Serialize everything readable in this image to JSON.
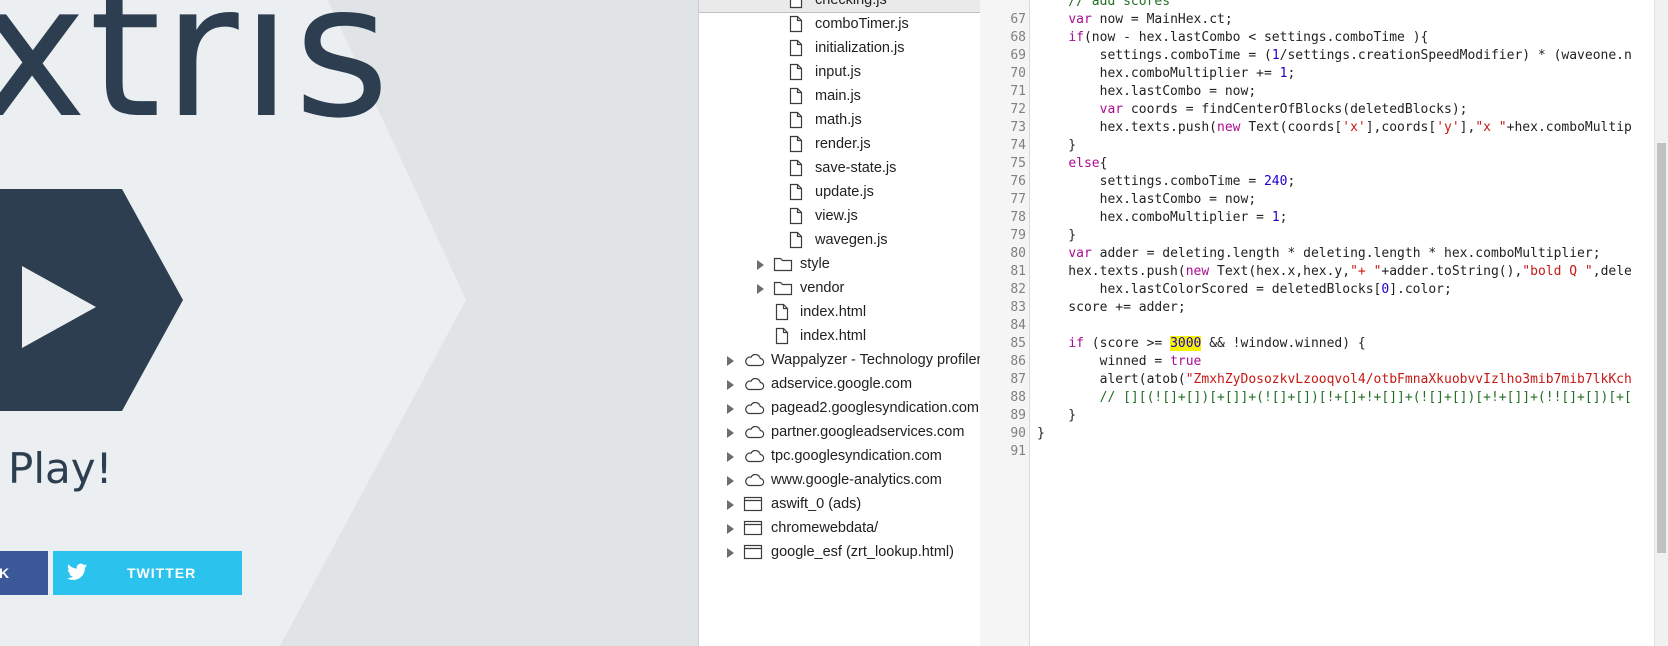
{
  "game": {
    "title": "xtris",
    "play_text": "Play!",
    "facebook_label": "K",
    "twitter_label": "TWITTER",
    "colors": {
      "background": "#e0e4e7",
      "hex_light": "#eceff1",
      "hex_dark": "#2c3e50",
      "facebook": "#3b5998",
      "twitter": "#2bc3ed"
    }
  },
  "file_tree": {
    "files": [
      "checking.js",
      "comboTimer.js",
      "initialization.js",
      "input.js",
      "main.js",
      "math.js",
      "render.js",
      "save-state.js",
      "update.js",
      "view.js",
      "wavegen.js"
    ],
    "folders": [
      "style",
      "vendor"
    ],
    "root_files": [
      "index.html",
      "index.html"
    ],
    "domains": [
      {
        "label": "Wappalyzer - Technology profiler",
        "icon": "cloud-icon"
      },
      {
        "label": "adservice.google.com",
        "icon": "cloud-icon"
      },
      {
        "label": "pagead2.googlesyndication.com",
        "icon": "cloud-icon"
      },
      {
        "label": "partner.googleadservices.com",
        "icon": "cloud-icon"
      },
      {
        "label": "tpc.googlesyndication.com",
        "icon": "cloud-icon"
      },
      {
        "label": "www.google-analytics.com",
        "icon": "cloud-icon"
      },
      {
        "label": "aswift_0 (ads)",
        "icon": "frame-icon"
      },
      {
        "label": "chromewebdata/",
        "icon": "frame-icon"
      },
      {
        "label": "google_esf (zrt_lookup.html)",
        "icon": "frame-icon"
      }
    ]
  },
  "editor": {
    "first_line_partial": "    // add scores",
    "lines": [
      {
        "n": "67",
        "html": "    <span class='kw'>var</span> now = MainHex.ct;"
      },
      {
        "n": "68",
        "html": "    <span class='kw'>if</span>(now - hex.lastCombo &lt; settings.comboTime ){"
      },
      {
        "n": "69",
        "html": "        settings.comboTime = (<span class='num'>1</span>/settings.creationSpeedModifier) * (waveone.n"
      },
      {
        "n": "70",
        "html": "        hex.comboMultiplier += <span class='num'>1</span>;"
      },
      {
        "n": "71",
        "html": "        hex.lastCombo = now;"
      },
      {
        "n": "72",
        "html": "        <span class='kw'>var</span> coords = findCenterOfBlocks(deletedBlocks);"
      },
      {
        "n": "73",
        "html": "        hex.texts.push(<span class='kw'>new</span> Text(coords[<span class='str'>'x'</span>],coords[<span class='str'>'y'</span>],<span class='str'>\"x \"</span>+hex.comboMultip"
      },
      {
        "n": "74",
        "html": "    }"
      },
      {
        "n": "75",
        "html": "    <span class='kw'>else</span>{"
      },
      {
        "n": "76",
        "html": "        settings.comboTime = <span class='num'>240</span>;"
      },
      {
        "n": "77",
        "html": "        hex.lastCombo = now;"
      },
      {
        "n": "78",
        "html": "        hex.comboMultiplier = <span class='num'>1</span>;"
      },
      {
        "n": "79",
        "html": "    }"
      },
      {
        "n": "80",
        "html": "    <span class='kw'>var</span> adder = deleting.length * deleting.length * hex.comboMultiplier;"
      },
      {
        "n": "81",
        "html": "    hex.texts.push(<span class='kw'>new</span> Text(hex.x,hex.y,<span class='str'>\"+ \"</span>+adder.toString(),<span class='str'>\"bold Q \"</span>,dele"
      },
      {
        "n": "82",
        "html": "        hex.lastColorScored = deletedBlocks[<span class='num'>0</span>].color;"
      },
      {
        "n": "83",
        "html": "    score += adder;"
      },
      {
        "n": "84",
        "html": ""
      },
      {
        "n": "85",
        "html": "    <span class='kw'>if</span> (score &gt;= <span class='num hl'>3000</span> &amp;&amp; !window.winned) {"
      },
      {
        "n": "86",
        "html": "        winned = <span class='kw'>true</span>"
      },
      {
        "n": "87",
        "html": "        alert(atob(<span class='str'>\"ZmxhZyDosozkvLzooqvol4/otbFmnaXkuobvvIzlho3mib7mib7lkKch</span>"
      },
      {
        "n": "88",
        "html": "        <span class='cmt'>// [][(![]+[])[+[]]+(![]+[])[!+[]+!+[]]+(![]+[])[+!+[]]+(!![]+[])[+[</span>"
      },
      {
        "n": "89",
        "html": "    }"
      },
      {
        "n": "90",
        "html": "}"
      },
      {
        "n": "91",
        "html": ""
      }
    ],
    "colors": {
      "keyword": "#aa0d91",
      "number": "#1c00cf",
      "string": "#c41a16",
      "comment": "#236e25",
      "highlight": "#f6f300"
    }
  }
}
